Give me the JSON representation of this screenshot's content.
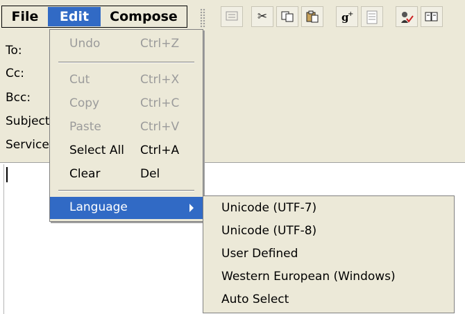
{
  "menubar": {
    "file": "File",
    "edit": "Edit",
    "compose": "Compose"
  },
  "toolbar": {
    "buttons": [
      {
        "icon": "address-book-icon",
        "enabled": false
      },
      {
        "icon": "scissors-icon",
        "glyph": "✂",
        "enabled": true
      },
      {
        "icon": "copy-icon",
        "enabled": true
      },
      {
        "icon": "paste-icon",
        "enabled": true
      },
      {
        "icon": "attach-icon",
        "glyph": "ᵍ⁺",
        "enabled": true
      },
      {
        "icon": "document-icon",
        "enabled": false
      },
      {
        "icon": "spell-check-icon",
        "enabled": true
      },
      {
        "icon": "book-icon",
        "enabled": true
      }
    ]
  },
  "fields": {
    "to": "To:",
    "cc": "Cc:",
    "bcc": "Bcc:",
    "subject": "Subject:",
    "service": "Service:"
  },
  "edit_menu": {
    "undo": {
      "label": "Undo",
      "shortcut": "Ctrl+Z"
    },
    "cut": {
      "label": "Cut",
      "shortcut": "Ctrl+X"
    },
    "copy": {
      "label": "Copy",
      "shortcut": "Ctrl+C"
    },
    "paste": {
      "label": "Paste",
      "shortcut": "Ctrl+V"
    },
    "select_all": {
      "label": "Select All",
      "shortcut": "Ctrl+A"
    },
    "clear": {
      "label": "Clear",
      "shortcut": "Del"
    },
    "language": {
      "label": "Language"
    }
  },
  "language_menu": {
    "items": [
      "Unicode (UTF-7)",
      "Unicode (UTF-8)",
      "User Defined",
      "Western European (Windows)",
      "Auto Select"
    ]
  },
  "colors": {
    "highlight": "#316ac5",
    "menu_bg": "#ece9d8",
    "disabled": "#9b9b9b"
  }
}
